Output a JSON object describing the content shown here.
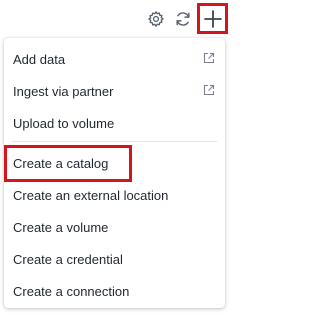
{
  "toolbar": {
    "settings_icon": "gear-icon",
    "refresh_icon": "refresh-icon",
    "add_icon": "plus-icon",
    "highlight_color": "#d4141e"
  },
  "menu": {
    "items": [
      {
        "label": "Add data",
        "icon": "external-link-icon"
      },
      {
        "label": "Ingest via partner",
        "icon": "external-link-icon"
      },
      {
        "label": "Upload to volume"
      },
      {
        "label": "Create a catalog"
      },
      {
        "label": "Create an external location"
      },
      {
        "label": "Create a volume"
      },
      {
        "label": "Create a credential"
      },
      {
        "label": "Create a connection"
      }
    ]
  }
}
